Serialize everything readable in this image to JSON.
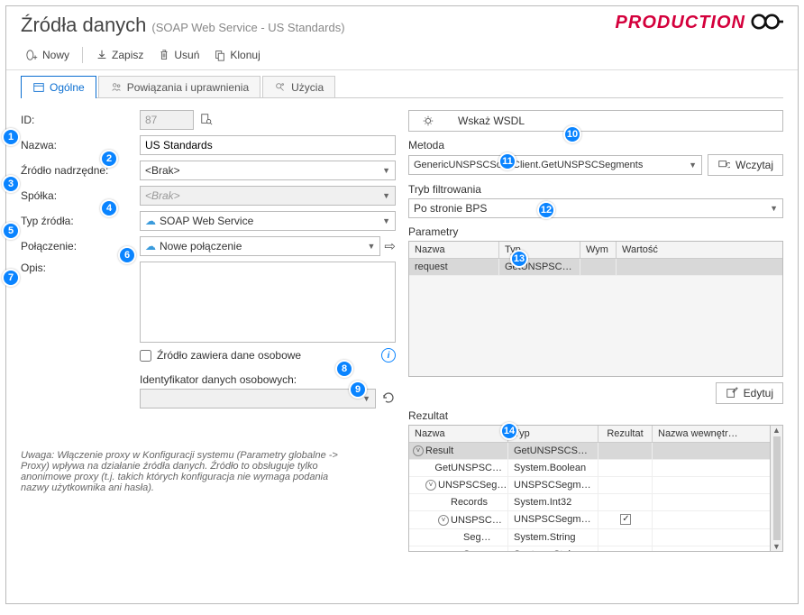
{
  "header": {
    "title": "Źródła danych",
    "subtitle": "(SOAP Web Service - US Standards)",
    "production_label": "PRODUCTION"
  },
  "toolbar": {
    "new": "Nowy",
    "save": "Zapisz",
    "delete": "Usuń",
    "clone": "Klonuj"
  },
  "tabs": {
    "general": "Ogólne",
    "assoc": "Powiązania i uprawnienia",
    "usage": "Użycia"
  },
  "form": {
    "id_label": "ID:",
    "id_value": "87",
    "name_label": "Nazwa:",
    "name_value": "US Standards",
    "parent_label": "Źródło nadrzędne:",
    "parent_value": "<Brak>",
    "company_label": "Spółka:",
    "company_value": "<Brak>",
    "type_label": "Typ źródła:",
    "type_value": "SOAP Web Service",
    "connection_label": "Połączenie:",
    "connection_value": "Nowe połączenie",
    "desc_label": "Opis:",
    "gdpr_label": "Źródło zawiera dane osobowe",
    "gdpr_id_label": "Identyfikator danych osobowych:"
  },
  "note": "Uwaga: Włączenie proxy w Konfiguracji systemu (Parametry globalne -> Proxy) wpływa na działanie źródła danych. Źródło to obsługuje tylko anonimowe proxy (t.j. takich których konfiguracja nie wymaga podania nazwy użytkownika ani hasła).",
  "right": {
    "wsdl_btn": "Wskaż WSDL",
    "method_label": "Metoda",
    "method_value": "GenericUNSPSCSoapClient.GetUNSPSCSegments",
    "load_btn": "Wczytaj",
    "filter_label": "Tryb filtrowania",
    "filter_value": "Po stronie BPS",
    "params_label": "Parametry",
    "params_head": {
      "c1": "Nazwa",
      "c2": "Typ",
      "c3": "Wym",
      "c4": "Wartość"
    },
    "params_row": {
      "c1": "request",
      "c2": "GetUNSPSCSe…"
    },
    "edit_btn": "Edytuj",
    "result_label": "Rezultat",
    "result_head": {
      "c1": "Nazwa",
      "c2": "Typ",
      "c3": "Rezultat",
      "c4": "Nazwa wewnętr…"
    },
    "result_rows": [
      {
        "name": "Result",
        "type": "GetUNSPSCS…",
        "indent": 0,
        "toggle": true,
        "selected": true
      },
      {
        "name": "GetUNSPSC…",
        "type": "System.Boolean",
        "indent": 1
      },
      {
        "name": "UNSPSCSeg…",
        "type": "UNSPSCSegm…",
        "indent": 1,
        "toggle": true
      },
      {
        "name": "Records",
        "type": "System.Int32",
        "indent": 2
      },
      {
        "name": "UNSPSC…",
        "type": "UNSPSCSegm…",
        "indent": 2,
        "toggle": true,
        "checked": true
      },
      {
        "name": "Seg…",
        "type": "System.String",
        "indent": 3
      },
      {
        "name": "San",
        "type": "Suntana Staian",
        "indent": 3
      }
    ]
  },
  "badges": [
    "1",
    "2",
    "3",
    "4",
    "5",
    "6",
    "7",
    "8",
    "9",
    "10",
    "11",
    "12",
    "13",
    "14"
  ]
}
